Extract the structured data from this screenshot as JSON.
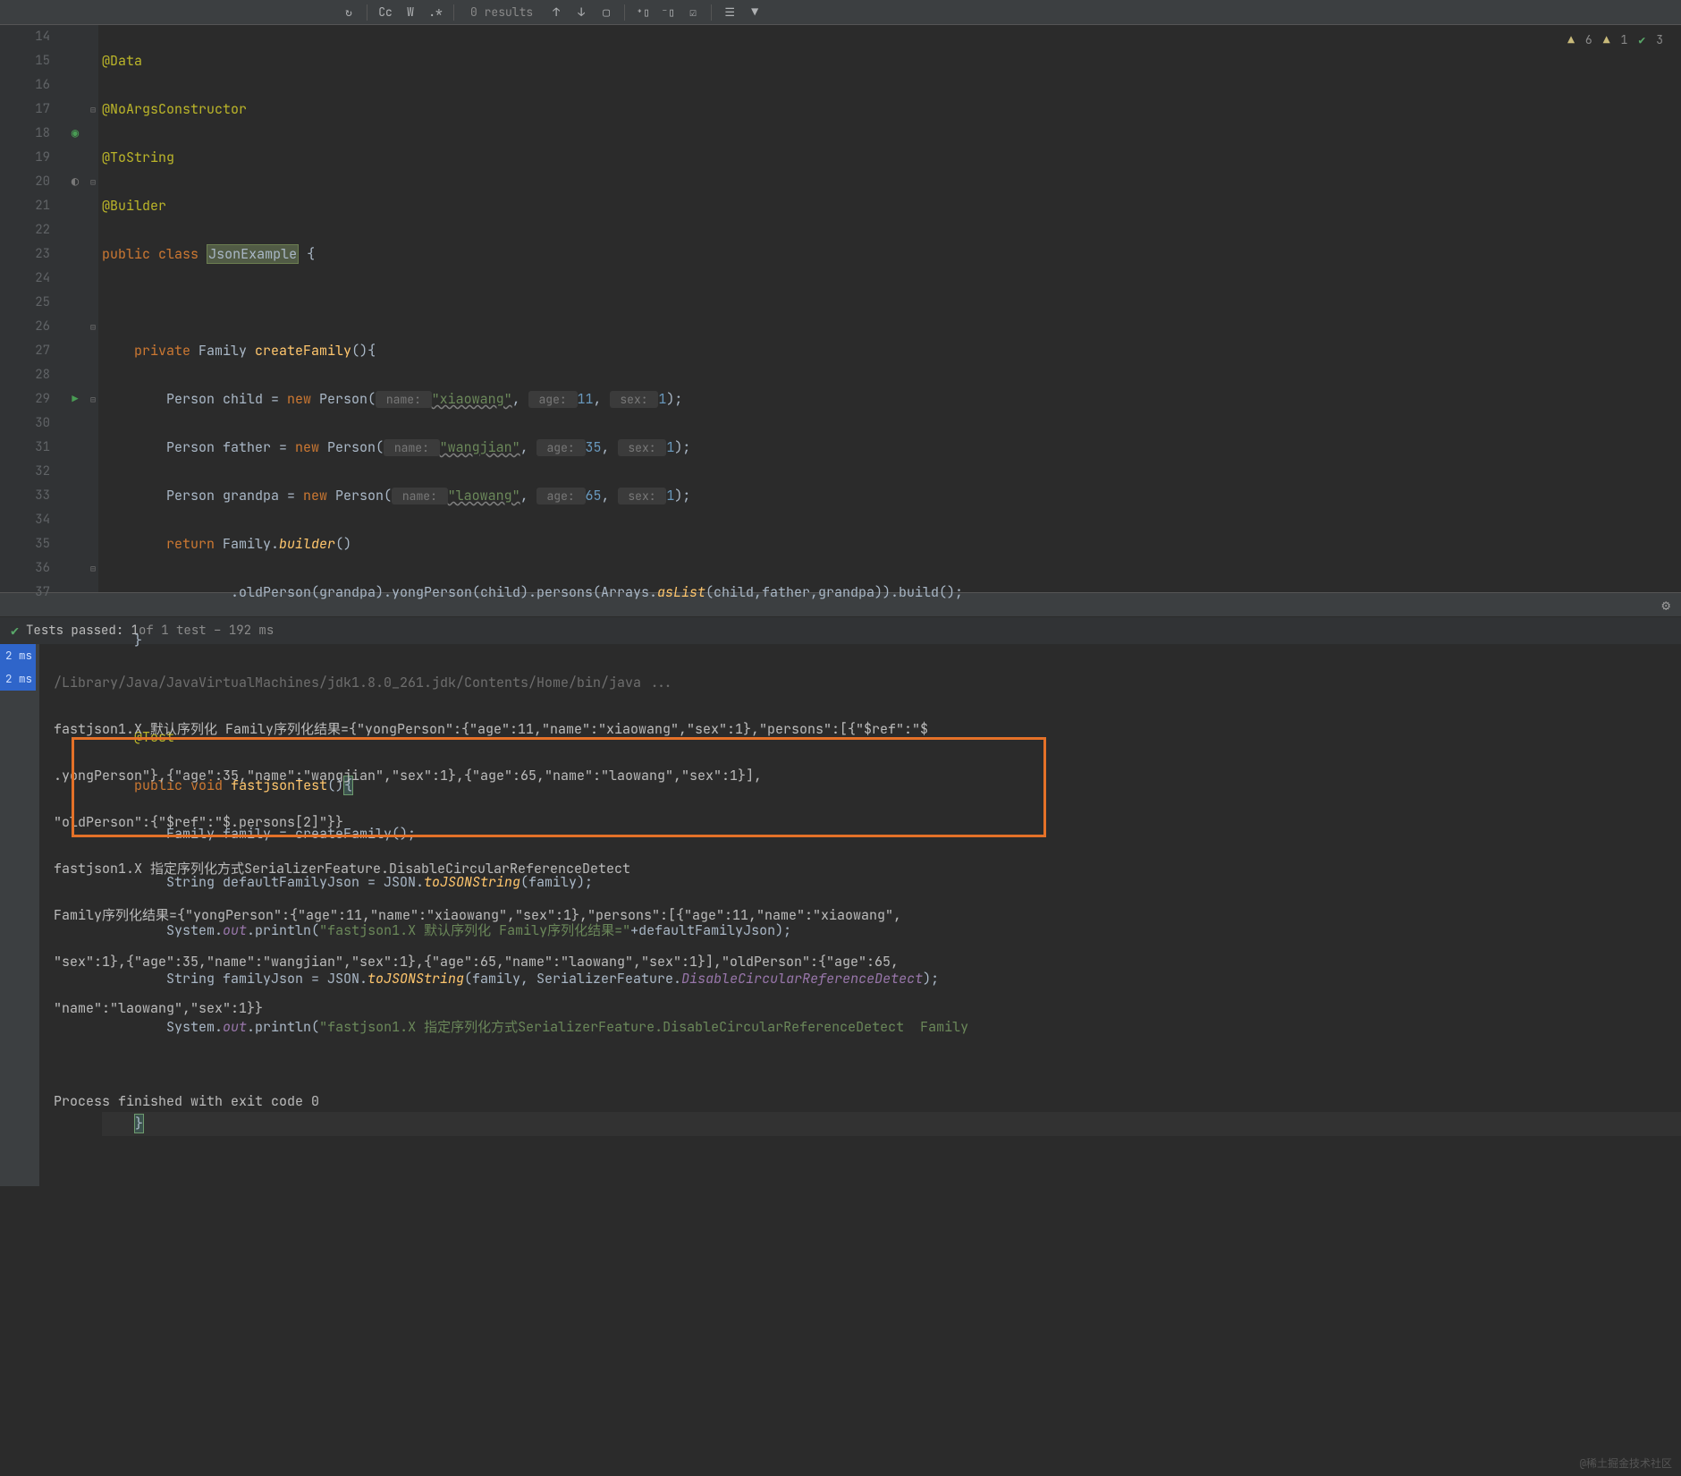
{
  "toolbar": {
    "results": "0 results",
    "cc": "Cc",
    "w": "W",
    "regex": ".*"
  },
  "indicators": {
    "warn1": "6",
    "warn2": "1",
    "ok": "3"
  },
  "gutter": [
    "14",
    "15",
    "16",
    "17",
    "18",
    "19",
    "20",
    "21",
    "22",
    "23",
    "24",
    "25",
    "26",
    "27",
    "28",
    "29",
    "30",
    "31",
    "32",
    "33",
    "34",
    "35",
    "36",
    "37"
  ],
  "code": {
    "l14": "@Data",
    "l15": "@NoArgsConstructor",
    "l16": "@ToString",
    "l17": "@Builder",
    "l18_public": "public",
    "l18_class": "class",
    "l18_name": "JsonExample",
    "l18_brace": " {",
    "l20_private": "private",
    "l20_family": " Family ",
    "l20_method": "createFamily",
    "l20_tail": "(){",
    "l21_person": "Person child = ",
    "l21_new": "new",
    "l21_tail": " Person(",
    "l21_h1": " name: ",
    "l21_s1": "\"xiaowang\"",
    "l21_c1": ", ",
    "l21_h2": " age: ",
    "l21_n1": "11",
    "l21_c2": ", ",
    "l21_h3": " sex: ",
    "l21_n2": "1",
    "l21_end": ");",
    "l22_person": "Person father = ",
    "l22_s1": "\"wangjian\"",
    "l22_n1": "35",
    "l23_person": "Person grandpa = ",
    "l23_s1": "\"laowang\"",
    "l23_n1": "65",
    "l24_return": "return",
    "l24_tail": " Family.",
    "l24_builder": "builder",
    "l24_end": "()",
    "l25_a": "                .oldPerson(grandpa).yongPerson(child).persons(Arrays.",
    "l25_aslist": "asList",
    "l25_b": "(child,father,grandpa)).build();",
    "l26": "}",
    "l28": "@Test",
    "l29_public": "public",
    "l29_void": "void",
    "l29_method": "fastjsonTest",
    "l29_tail": "()",
    "l29_brace": "{",
    "l30": "Family family = createFamily();",
    "l31_a": "String defaultFamilyJson = JSON.",
    "l31_m": "toJSONString",
    "l31_b": "(family);",
    "l32_a": "System.",
    "l32_out": "out",
    "l32_b": ".println(",
    "l32_s": "\"fastjson1.X 默认序列化 Family序列化结果=\"",
    "l32_c": "+defaultFamilyJson);",
    "l33_a": "String familyJson = JSON.",
    "l33_m": "toJSONString",
    "l33_b": "(family, SerializerFeature.",
    "l33_f": "DisableCircularReferenceDetect",
    "l33_c": ");",
    "l34_s": "\"fastjson1.X 指定序列化方式SerializerFeature.DisableCircularReferenceDetect  Family",
    "l36": "}"
  },
  "tests": {
    "passed": "Tests passed: 1",
    "rest": " of 1 test – 192 ms"
  },
  "time": {
    "t1": "2 ms",
    "t2": "2 ms"
  },
  "console": {
    "cmd": "/Library/Java/JavaVirtualMachines/jdk1.8.0_261.jdk/Contents/Home/bin/java ...",
    "l1": "fastjson1.X 默认序列化 Family序列化结果={\"yongPerson\":{\"age\":11,\"name\":\"xiaowang\",\"sex\":1},\"persons\":[{\"$ref\":\"$",
    "l2": ".yongPerson\"},{\"age\":35,\"name\":\"wangjian\",\"sex\":1},{\"age\":65,\"name\":\"laowang\",\"sex\":1}],",
    "l3": "\"oldPerson\":{\"$ref\":\"$.persons[2]\"}}",
    "l4": "fastjson1.X 指定序列化方式SerializerFeature.DisableCircularReferenceDetect ",
    "l5": "Family序列化结果={\"yongPerson\":{\"age\":11,\"name\":\"xiaowang\",\"sex\":1},\"persons\":[{\"age\":11,\"name\":\"xiaowang\",",
    "l6": "\"sex\":1},{\"age\":35,\"name\":\"wangjian\",\"sex\":1},{\"age\":65,\"name\":\"laowang\",\"sex\":1}],\"oldPerson\":{\"age\":65,",
    "l7": "\"name\":\"laowang\",\"sex\":1}}",
    "exit": "Process finished with exit code 0"
  },
  "watermark": "@稀土掘金技术社区"
}
